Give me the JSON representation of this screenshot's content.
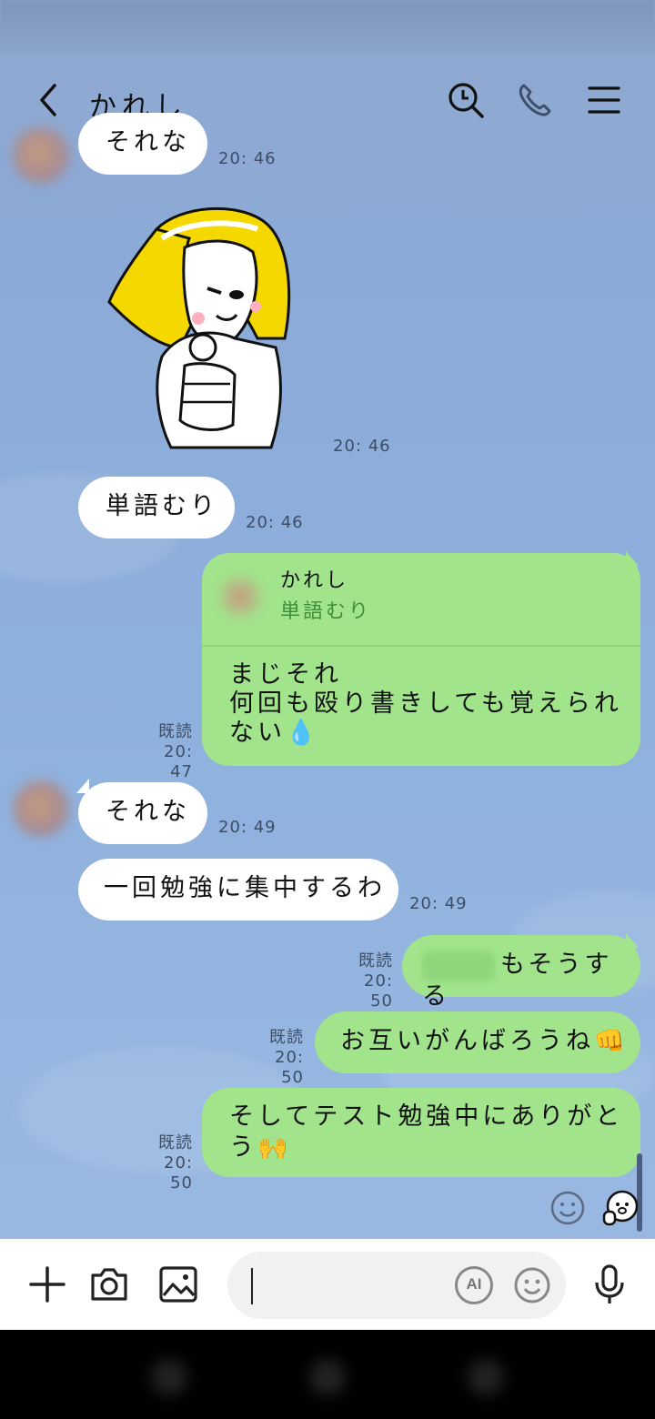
{
  "header": {
    "title": "かれし"
  },
  "messages": [
    {
      "type": "text",
      "side": "in",
      "text": "それな",
      "time": "20: 46"
    },
    {
      "type": "sticker",
      "side": "in",
      "time": "20: 46"
    },
    {
      "type": "text",
      "side": "in",
      "text": "単語むり",
      "time": "20: 46"
    },
    {
      "type": "reply",
      "side": "out",
      "reply_to_name": "かれし",
      "reply_to_text": "単語むり",
      "lines": [
        "まじそれ",
        "何回も殴り書きしても覚えられ",
        "ない💧"
      ],
      "read": "既読",
      "time": "20: 47"
    },
    {
      "type": "text",
      "side": "in",
      "text": "それな",
      "time": "20: 49"
    },
    {
      "type": "text",
      "side": "in",
      "text": "一回勉強に集中するわ",
      "time": "20: 49"
    },
    {
      "type": "text",
      "side": "out",
      "text": "もそうする",
      "read": "既読",
      "time": "20: 50"
    },
    {
      "type": "text",
      "side": "out",
      "text": "お互いがんばろうね👊",
      "read": "既読",
      "time": "20: 50"
    },
    {
      "type": "text",
      "side": "out",
      "lines": [
        "そしてテスト勉強中にありがと",
        "う🙌"
      ],
      "read": "既読",
      "time": "20: 50"
    }
  ],
  "input": {
    "ai_label": "AI",
    "placeholder": ""
  },
  "icons": [
    "back-icon",
    "search-icon",
    "phone-icon",
    "menu-icon",
    "plus-icon",
    "camera-icon",
    "image-icon",
    "emoji-icon",
    "mic-icon",
    "sticker-suggest-icon"
  ],
  "colors": {
    "background": "#8caad7",
    "outgoing_bubble": "#a1e48c",
    "incoming_bubble": "#ffffff",
    "reply_text": "#3f8f3a"
  }
}
